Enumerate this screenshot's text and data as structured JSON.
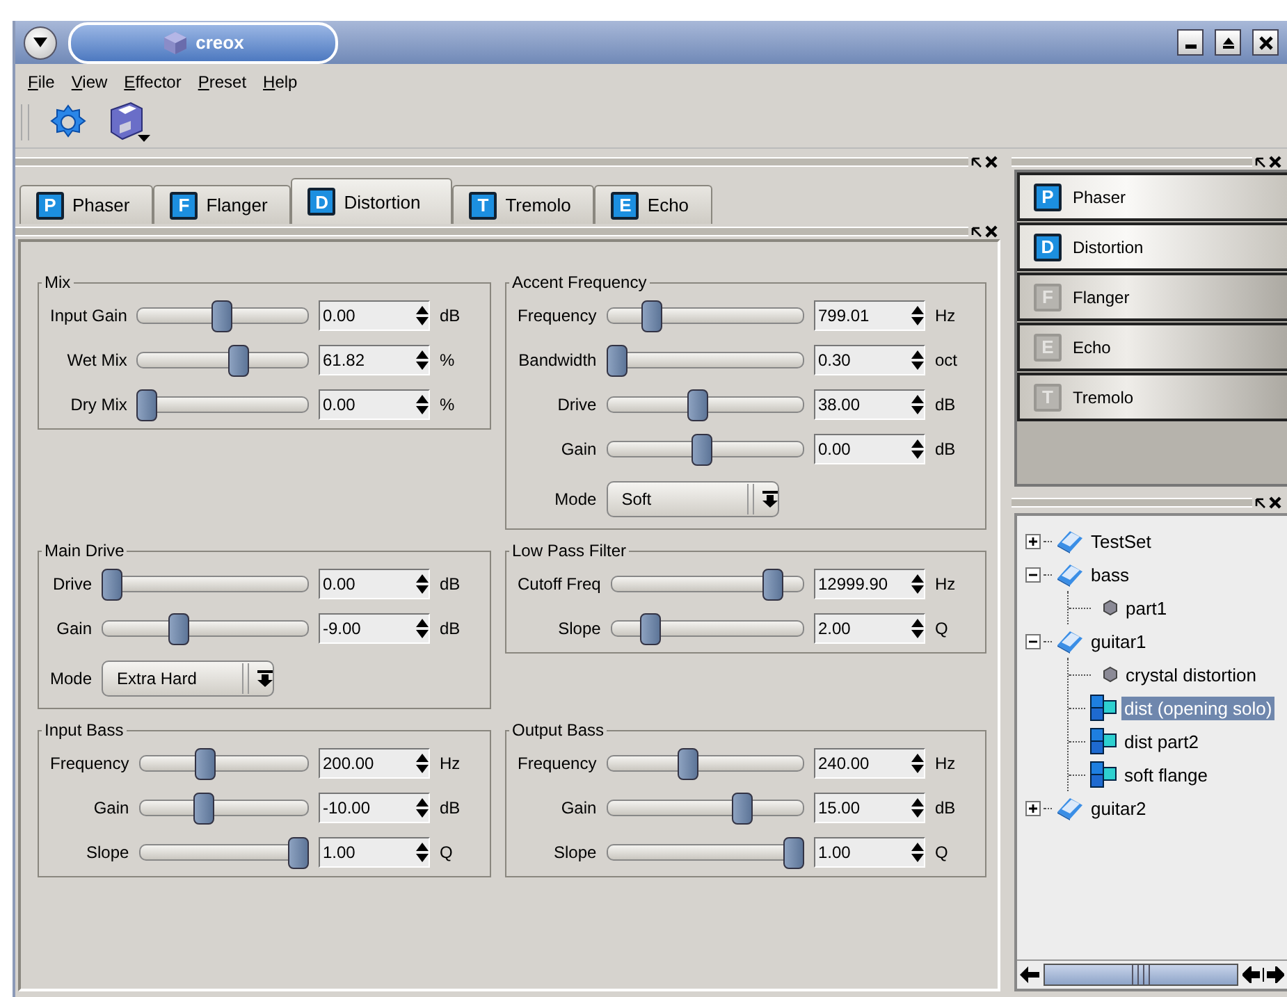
{
  "window": {
    "title": "creox"
  },
  "menu": [
    "File",
    "View",
    "Effector",
    "Preset",
    "Help"
  ],
  "tabs": [
    {
      "letter": "P",
      "label": "Phaser",
      "selected": false
    },
    {
      "letter": "F",
      "label": "Flanger",
      "selected": false
    },
    {
      "letter": "D",
      "label": "Distortion",
      "selected": true
    },
    {
      "letter": "T",
      "label": "Tremolo",
      "selected": false
    },
    {
      "letter": "E",
      "label": "Echo",
      "selected": false
    }
  ],
  "sections": [
    {
      "title": "Mix",
      "controls": [
        {
          "kind": "slider",
          "label": "Input Gain",
          "level": 0.49,
          "value": "0.00",
          "unit": "dB"
        },
        {
          "kind": "slider",
          "label": "Wet Mix",
          "level": 0.6,
          "value": "61.82",
          "unit": "%"
        },
        {
          "kind": "slider",
          "label": "Dry Mix",
          "level": 0,
          "value": "0.00",
          "unit": "%"
        }
      ]
    },
    {
      "title": "Accent Frequency",
      "controls": [
        {
          "kind": "slider",
          "label": "Frequency",
          "level": 0.2,
          "value": "799.01",
          "unit": "Hz"
        },
        {
          "kind": "slider",
          "label": "Bandwidth",
          "level": 0,
          "value": "0.30",
          "unit": "oct"
        },
        {
          "kind": "slider",
          "label": "Drive",
          "level": 0.46,
          "value": "38.00",
          "unit": "dB"
        },
        {
          "kind": "slider",
          "label": "Gain",
          "level": 0.48,
          "value": "0.00",
          "unit": "dB"
        },
        {
          "kind": "select",
          "label": "Mode",
          "value": "Soft"
        }
      ]
    },
    {
      "title": "Main Drive",
      "controls": [
        {
          "kind": "slider",
          "label": "Drive",
          "level": 0,
          "value": "0.00",
          "unit": "dB"
        },
        {
          "kind": "slider",
          "label": "Gain",
          "level": 0.36,
          "value": "-9.00",
          "unit": "dB"
        },
        {
          "kind": "select",
          "label": "Mode",
          "value": "Extra Hard"
        }
      ]
    },
    {
      "title": "Low Pass Filter",
      "controls": [
        {
          "kind": "slider",
          "label": "Cutoff Freq",
          "level": 0.88,
          "value": "12999.90",
          "unit": "Hz"
        },
        {
          "kind": "slider",
          "label": "Slope",
          "level": 0.17,
          "value": "2.00",
          "unit": "Q"
        }
      ]
    },
    {
      "title": "Input Bass",
      "controls": [
        {
          "kind": "slider",
          "label": "Frequency",
          "level": 0.38,
          "value": "200.00",
          "unit": "Hz"
        },
        {
          "kind": "slider",
          "label": "Gain",
          "level": 0.37,
          "value": "-10.00",
          "unit": "dB"
        },
        {
          "kind": "slider",
          "label": "Slope",
          "level": 1,
          "value": "1.00",
          "unit": "Q"
        }
      ]
    },
    {
      "title": "Output Bass",
      "controls": [
        {
          "kind": "slider",
          "label": "Frequency",
          "level": 0.4,
          "value": "240.00",
          "unit": "Hz"
        },
        {
          "kind": "slider",
          "label": "Gain",
          "level": 0.71,
          "value": "15.00",
          "unit": "dB"
        },
        {
          "kind": "slider",
          "label": "Slope",
          "level": 1,
          "value": "1.00",
          "unit": "Q"
        }
      ]
    }
  ],
  "effect_rack": [
    {
      "letter": "P",
      "label": "Phaser",
      "enabled": true
    },
    {
      "letter": "D",
      "label": "Distortion",
      "enabled": true
    },
    {
      "letter": "F",
      "label": "Flanger",
      "enabled": false
    },
    {
      "letter": "E",
      "label": "Echo",
      "enabled": false
    },
    {
      "letter": "T",
      "label": "Tremolo",
      "enabled": false
    }
  ],
  "tree": [
    {
      "label": "TestSet",
      "kind": "set",
      "expanded": false,
      "selected": false
    },
    {
      "label": "bass",
      "kind": "set",
      "expanded": true,
      "selected": false,
      "children": [
        {
          "label": "part1",
          "kind": "part",
          "selected": false
        }
      ]
    },
    {
      "label": "guitar1",
      "kind": "set",
      "expanded": true,
      "selected": false,
      "children": [
        {
          "label": "crystal distortion",
          "kind": "part",
          "selected": false
        },
        {
          "label": "dist (opening solo)",
          "kind": "effect",
          "selected": true
        },
        {
          "label": "dist part2",
          "kind": "effect",
          "selected": false
        },
        {
          "label": "soft flange",
          "kind": "effect",
          "selected": false
        }
      ]
    },
    {
      "label": "guitar2",
      "kind": "set",
      "expanded": false,
      "selected": false
    }
  ]
}
